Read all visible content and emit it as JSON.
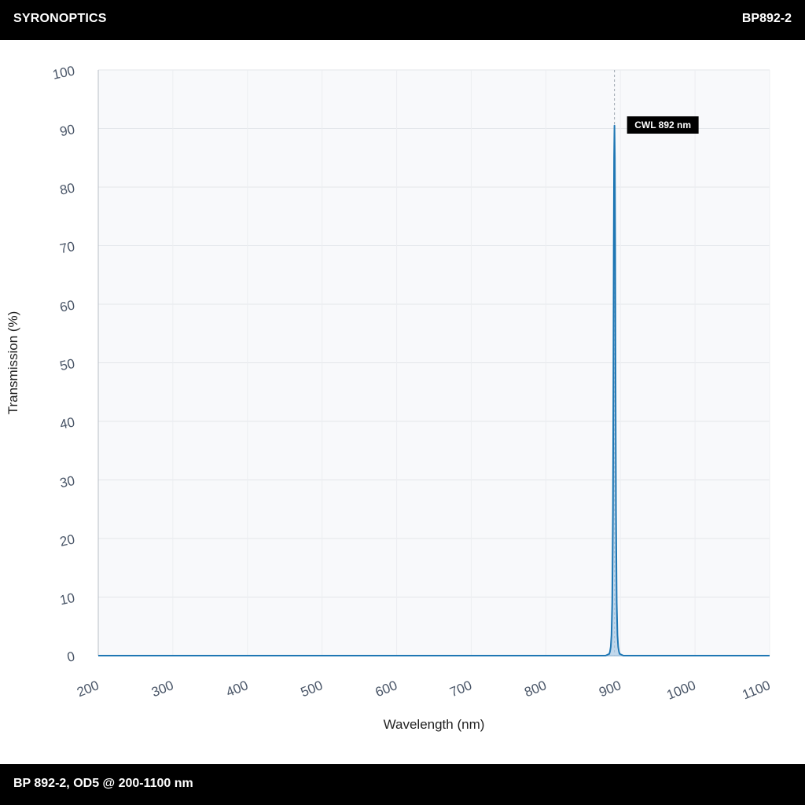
{
  "header": {
    "brand": "SYRONOPTICS",
    "part_number": "BP892-2"
  },
  "footer": {
    "caption": "BP 892-2, OD5 @ 200-1100 nm"
  },
  "colors": {
    "header_bg": "#000000",
    "plot_bg": "#f8f9fb",
    "line": "#1f77b4",
    "fill": "#a9cbe6",
    "annotation_bg": "#000000"
  },
  "chart_data": {
    "type": "area",
    "title": "",
    "xlabel": "Wavelength (nm)",
    "ylabel": "Transmission (%)",
    "xlim": [
      200,
      1100
    ],
    "ylim": [
      0,
      100
    ],
    "x_ticks": [
      200,
      300,
      400,
      500,
      600,
      700,
      800,
      900,
      1000,
      1100
    ],
    "y_ticks": [
      0,
      10,
      20,
      30,
      40,
      50,
      60,
      70,
      80,
      90,
      100
    ],
    "grid": true,
    "series": [
      {
        "x": [
          200,
          880,
          885,
          886,
          887,
          888,
          889,
          890,
          890.5,
          891,
          891.5,
          892,
          892.5,
          893,
          893.5,
          894,
          895,
          896,
          897,
          898,
          899,
          904,
          1100
        ],
        "y": [
          0,
          0,
          0.3,
          0.7,
          1.5,
          3.5,
          9,
          25,
          45,
          70,
          85,
          90.5,
          85,
          70,
          45,
          25,
          9,
          3.5,
          1.5,
          0.7,
          0.3,
          0,
          0
        ]
      }
    ],
    "annotation": {
      "x": 892,
      "text": "CWL 892 nm"
    }
  }
}
